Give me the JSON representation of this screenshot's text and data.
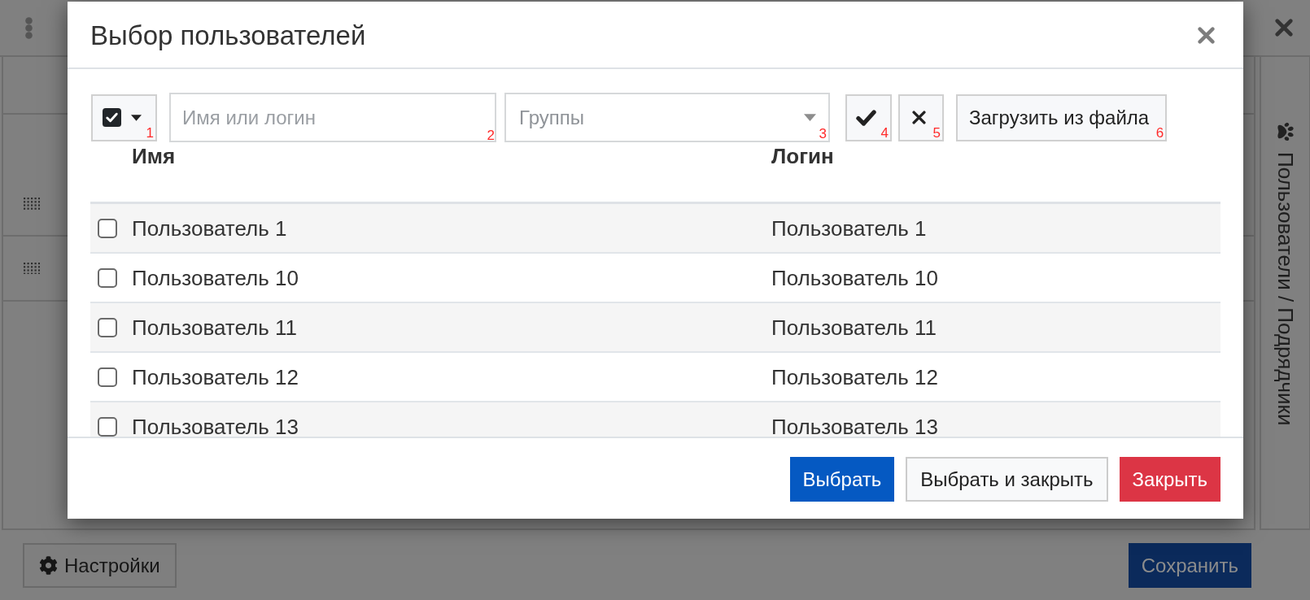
{
  "page": {
    "side_tab": {
      "label": "Пользователи / Подрядчики"
    },
    "footer_buttons": [
      {
        "label": "Настройки",
        "kind": "settings"
      },
      {
        "label": "Сохранить",
        "kind": "save"
      }
    ]
  },
  "dialog": {
    "title": "Выбор пользователей",
    "toolbar": [
      {
        "kind": "checkmenu",
        "checked": true,
        "marker": "1"
      },
      {
        "kind": "input",
        "placeholder": "Имя или логин",
        "marker": "2"
      },
      {
        "kind": "select",
        "placeholder": "Группы",
        "marker": "3"
      },
      {
        "kind": "accept",
        "marker": "4"
      },
      {
        "kind": "clear",
        "marker": "5"
      },
      {
        "kind": "button",
        "label": "Загрузить из файла",
        "marker": "6"
      }
    ],
    "table": {
      "columns": [
        "Имя",
        "Логин"
      ],
      "rows": [
        {
          "name": "Пользователь 1",
          "login": "Пользователь 1",
          "checked": false
        },
        {
          "name": "Пользователь 10",
          "login": "Пользователь 10",
          "checked": false
        },
        {
          "name": "Пользователь 11",
          "login": "Пользователь 11",
          "checked": false
        },
        {
          "name": "Пользователь 12",
          "login": "Пользователь 12",
          "checked": false
        },
        {
          "name": "Пользователь 13",
          "login": "Пользователь 13",
          "checked": false
        }
      ]
    },
    "buttons": [
      {
        "label": "Выбрать",
        "kind": "primary"
      },
      {
        "label": "Выбрать и закрыть",
        "kind": "secondary"
      },
      {
        "label": "Закрыть",
        "kind": "danger"
      }
    ]
  }
}
